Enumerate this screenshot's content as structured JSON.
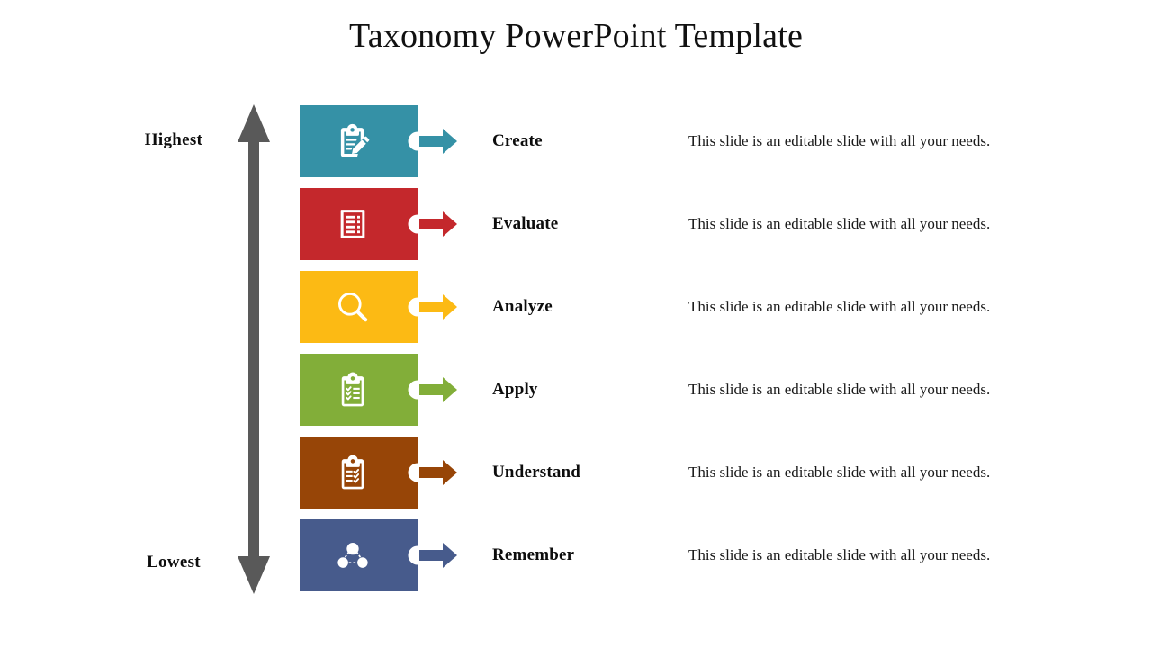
{
  "title": "Taxonomy PowerPoint Template",
  "scale": {
    "top_label": "Highest",
    "bottom_label": "Lowest",
    "arrow_color": "#595959",
    "arrow_icon": "double-headed-vertical-arrow-icon"
  },
  "rows": [
    {
      "label": "Create",
      "description": "This slide is an editable slide with all your needs.",
      "color": "#3591A6",
      "icon": "clipboard-pencil-icon"
    },
    {
      "label": "Evaluate",
      "description": "This slide is an editable slide with all your needs.",
      "color": "#C4282C",
      "icon": "checklist-form-icon"
    },
    {
      "label": "Analyze",
      "description": "This slide is an editable slide with all your needs.",
      "color": "#FCBA14",
      "icon": "magnifier-icon"
    },
    {
      "label": "Apply",
      "description": "This slide is an editable slide with all your needs.",
      "color": "#82AE39",
      "icon": "clipboard-checkmarks-icon"
    },
    {
      "label": "Understand",
      "description": "This slide is an editable slide with all your needs.",
      "color": "#974507",
      "icon": "clipboard-tasks-icon"
    },
    {
      "label": "Remember",
      "description": "This slide is an editable slide with all your needs.",
      "color": "#475B8C",
      "icon": "people-network-icon"
    }
  ]
}
